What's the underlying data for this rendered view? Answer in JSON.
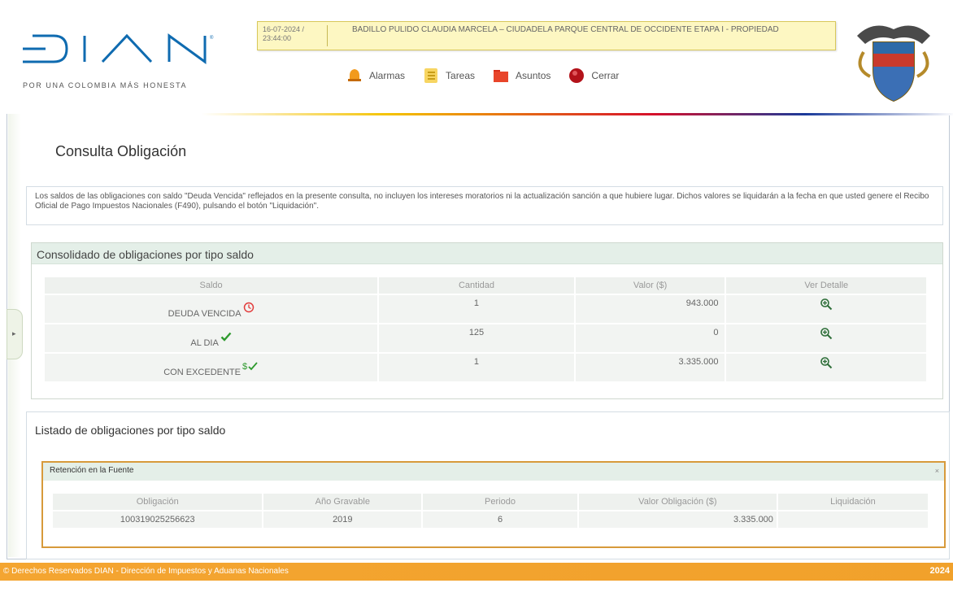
{
  "header": {
    "logo_text": "DIAN",
    "tagline": "POR UNA COLOMBIA MÁS HONESTA",
    "user": {
      "datetime": "16-07-2024 / 23:44:00",
      "name": "BADILLO PULIDO CLAUDIA MARCELA – CIUDADELA PARQUE CENTRAL DE OCCIDENTE ETAPA I - PROPIEDAD"
    },
    "toolbar": [
      {
        "label": "Alarmas",
        "icon": "bell-icon"
      },
      {
        "label": "Tareas",
        "icon": "task-list-icon"
      },
      {
        "label": "Asuntos",
        "icon": "folder-icon"
      },
      {
        "label": "Cerrar",
        "icon": "close-circle-icon"
      }
    ]
  },
  "page": {
    "title": "Consulta Obligación",
    "notice": "Los saldos de las obligaciones con saldo \"Deuda Vencida\" reflejados en la presente consulta, no incluyen los intereses moratorios ni la actualización sanción a que hubiere lugar. Dichos valores se liquidarán a la fecha en que usted genere el Recibo Oficial de Pago Impuestos Nacionales (F490), pulsando el botón \"Liquidación\"."
  },
  "consolidado": {
    "title": "Consolidado de obligaciones por tipo saldo",
    "columns": [
      "Saldo",
      "Cantidad",
      "Valor ($)",
      "Ver Detalle"
    ],
    "rows": [
      {
        "saldo": "DEUDA VENCIDA",
        "cantidad": "1",
        "valor": "943.000",
        "icon": "clock-icon"
      },
      {
        "saldo": "AL DIA",
        "cantidad": "125",
        "valor": "0",
        "icon": "check-icon"
      },
      {
        "saldo": "CON EXCEDENTE",
        "cantidad": "1",
        "valor": "3.335.000",
        "icon": "money-check-icon"
      }
    ]
  },
  "listado": {
    "title": "Listado de obligaciones por tipo saldo",
    "group_title": "Retención en la Fuente",
    "close_label": "×",
    "columns": [
      "Obligación",
      "Año Gravable",
      "Periodo",
      "Valor Obligación ($)",
      "Liquidación"
    ],
    "rows": [
      {
        "obligacion": "100319025256623",
        "anio": "2019",
        "periodo": "6",
        "valor": "3.335.000",
        "liquidacion": ""
      }
    ]
  },
  "footer": {
    "left": "© Derechos Reservados DIAN - Dirección de Impuestos y Aduanas Nacionales",
    "right": "2024"
  },
  "colors": {
    "dian_blue": "#0f6bb0",
    "footer_orange": "#f4a531",
    "panel_header": "#e4efe8",
    "sub_border": "#d79a3b"
  }
}
